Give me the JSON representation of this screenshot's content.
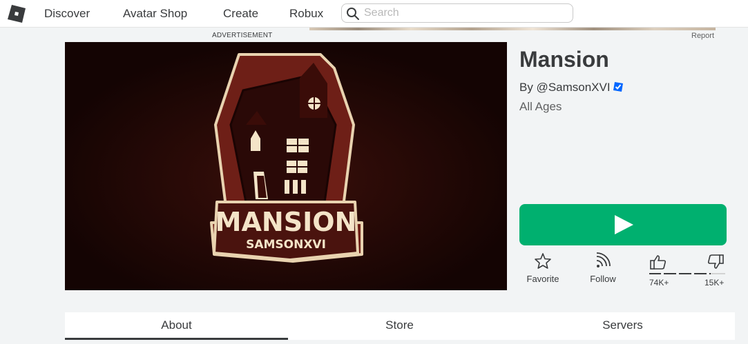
{
  "nav": {
    "items": [
      {
        "label": "Discover"
      },
      {
        "label": "Avatar Shop"
      },
      {
        "label": "Create"
      },
      {
        "label": "Robux"
      }
    ],
    "search_placeholder": "Search"
  },
  "ad": {
    "label": "ADVERTISEMENT",
    "report": "Report"
  },
  "game": {
    "title": "Mansion",
    "creator": "By @SamsonXVI",
    "age_rating": "All Ages",
    "thumbnail": {
      "logo_title": "MANSION",
      "logo_subtitle": "SAMSONXVI"
    }
  },
  "actions": {
    "play_icon": "play-icon",
    "favorite": "Favorite",
    "follow": "Follow",
    "upvotes": "74K+",
    "downvotes": "15K+"
  },
  "tabs": [
    {
      "label": "About",
      "active": true
    },
    {
      "label": "Store",
      "active": false
    },
    {
      "label": "Servers",
      "active": false
    }
  ],
  "colors": {
    "play_green": "#00b06f",
    "verified_blue": "#0066ff",
    "thumbnail_bg": "#1a0604",
    "logo_maroon": "#5a1a14",
    "logo_cream": "#f4e4c8"
  }
}
